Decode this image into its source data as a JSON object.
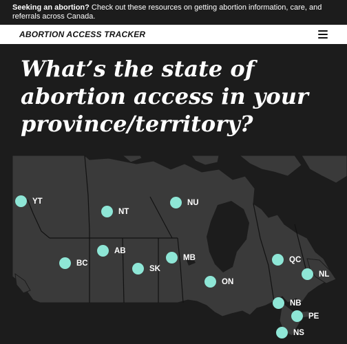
{
  "notice": {
    "bold": "Seeking an abortion?",
    "text": " Check out these resources on getting abortion information, care, and referrals across Canada."
  },
  "navbar": {
    "brand": "ABORTION ACCESS TRACKER",
    "menu_icon": "hamburger-menu-icon"
  },
  "headline": "What’s the state of abortion access in your province/territory?",
  "map": {
    "marker_color": "#8ee6d6",
    "land_color": "#3a3a3a",
    "water_color": "#1c1c1c",
    "markers": [
      {
        "code": "YT"
      },
      {
        "code": "NT"
      },
      {
        "code": "NU"
      },
      {
        "code": "AB"
      },
      {
        "code": "BC"
      },
      {
        "code": "SK"
      },
      {
        "code": "MB"
      },
      {
        "code": "ON"
      },
      {
        "code": "QC"
      },
      {
        "code": "NL"
      },
      {
        "code": "NB"
      },
      {
        "code": "PE"
      },
      {
        "code": "NS"
      }
    ]
  }
}
